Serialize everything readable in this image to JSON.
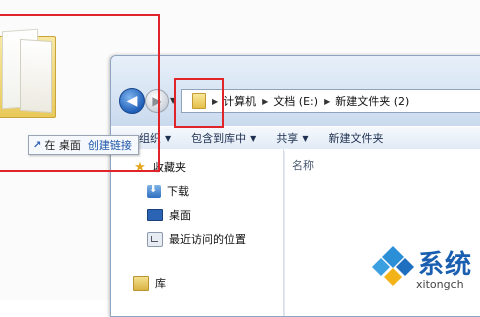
{
  "drag": {
    "target_label": "在 桌面",
    "action_label": "创建链接"
  },
  "explorer": {
    "breadcrumb": [
      "计算机",
      "文档 (E:)",
      "新建文件夹 (2)"
    ],
    "toolbar": [
      {
        "label": "组织",
        "has_dropdown": true
      },
      {
        "label": "包含到库中",
        "has_dropdown": true
      },
      {
        "label": "共享",
        "has_dropdown": true
      },
      {
        "label": "新建文件夹",
        "has_dropdown": false
      }
    ],
    "nav_pane": {
      "favorites_label": "收藏夹",
      "items": [
        "下载",
        "桌面",
        "最近访问的位置"
      ],
      "library_label": "库"
    },
    "content": {
      "column_name": "名称"
    }
  },
  "watermark": {
    "text": "系统",
    "url": "xitongch"
  },
  "colors": {
    "highlight_box": "#e0242a",
    "link_blue": "#1d56a8",
    "window_chrome": "#dfe9f5"
  }
}
